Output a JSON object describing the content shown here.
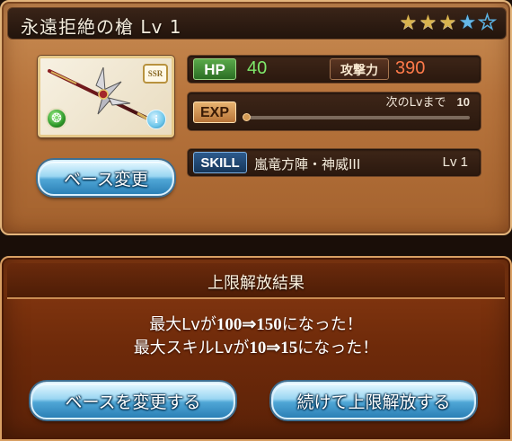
{
  "weapon": {
    "title": "永遠拒絶の槍 Lv 1",
    "stars": [
      "gold",
      "gold",
      "gold",
      "blue",
      "empty"
    ],
    "rarity": "SSR",
    "element_icon": "wind-element-icon",
    "info_icon_glyph": "i"
  },
  "stats": {
    "hp_label": "HP",
    "hp_value": "40",
    "atk_label": "攻撃力",
    "atk_value": "390",
    "exp_label": "EXP",
    "exp_next_label": "次のLvまで",
    "exp_next_value": "10",
    "exp_progress": 0,
    "skill_label": "SKILL",
    "skill_name": "嵐竜方陣・神威III",
    "skill_level": "Lv 1"
  },
  "buttons": {
    "change_base": "ベース変更",
    "change_base_2": "ベースを変更する",
    "continue_uncap": "続けて上限解放する"
  },
  "result": {
    "title": "上限解放結果",
    "line1_prefix": "最大Lvが",
    "line1_value": "100⇒150",
    "line1_suffix": "になった！",
    "line2_prefix": "最大スキルLvが",
    "line2_value": "10⇒15",
    "line2_suffix": "になった！"
  },
  "colors": {
    "hp": "#7fe86b",
    "atk": "#ff7a4a",
    "panel_brown": "#b8753d",
    "result_red": "#6e2a0a",
    "button_blue": "#4fa6d6"
  }
}
